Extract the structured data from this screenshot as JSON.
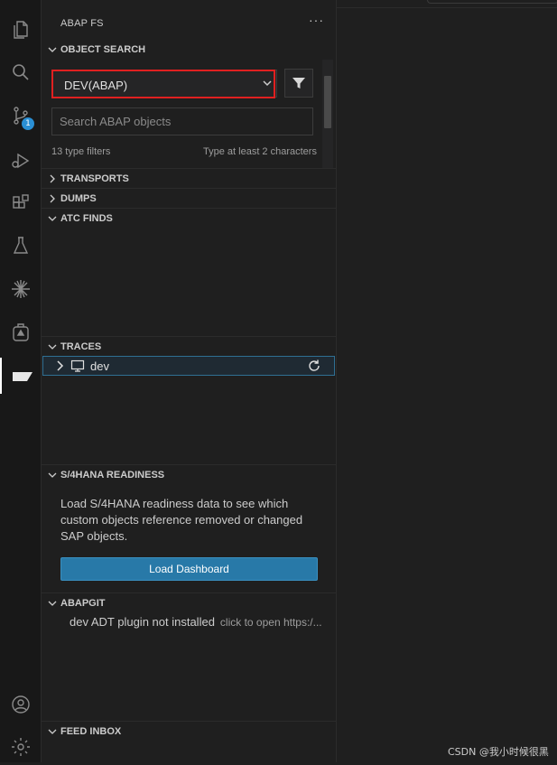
{
  "sidebar": {
    "title": "ABAP FS",
    "more_actions": "···"
  },
  "activity": {
    "scm_badge": "1"
  },
  "object_search": {
    "header": "OBJECT SEARCH",
    "system_select_value": "DEV(ABAP)",
    "search_placeholder": "Search ABAP objects",
    "type_filters": "13 type filters",
    "hint": "Type at least 2 characters"
  },
  "sections": {
    "transports": "TRANSPORTS",
    "dumps": "DUMPS",
    "atc_finds": "ATC FINDS",
    "traces": "TRACES",
    "s4hana": "S/4HANA READINESS",
    "abapgit": "ABAPGIT",
    "feed_inbox": "FEED INBOX"
  },
  "traces": {
    "item_label": "dev"
  },
  "s4hana": {
    "description": "Load S/4HANA readiness data to see which custom objects reference removed or changed SAP objects.",
    "button_label": "Load Dashboard"
  },
  "abapgit": {
    "item_label": "dev ADT plugin not installed",
    "item_description": "click to open https:/..."
  },
  "watermark": "CSDN @我小时候很黑",
  "colors": {
    "highlight_border": "#e02020",
    "button_bg": "#2879a8",
    "badge_bg": "#2a8fd4"
  }
}
